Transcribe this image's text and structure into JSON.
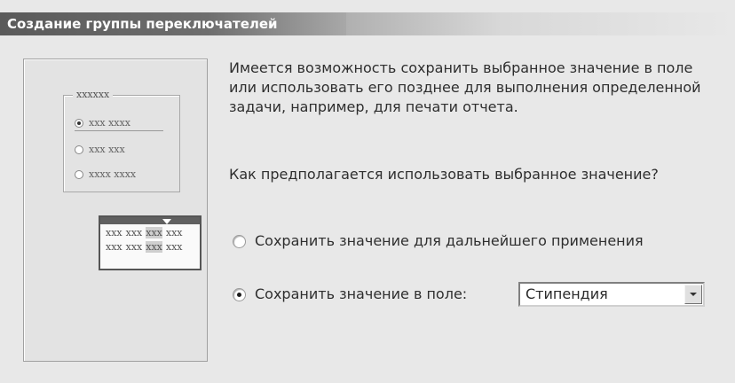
{
  "window": {
    "title": "Создание группы переключателей"
  },
  "preview": {
    "group_label": "xxxxxx",
    "radios": [
      "xxx xxxx",
      "xxx xxx",
      "xxxx xxxx"
    ],
    "selected_index": 0,
    "table_rows": [
      [
        "xxx",
        "xxx",
        "xxx",
        "xxx"
      ],
      [
        "xxx",
        "xxx",
        "xxx",
        "xxx"
      ]
    ]
  },
  "main": {
    "intro": "Имеется возможность сохранить выбранное значение в поле или использовать его позднее для выполнения определенной задачи, например, для печати отчета.",
    "question": "Как предполагается использовать выбранное значение?",
    "options": [
      {
        "label": "Сохранить значение для дальнейшего применения",
        "selected": false
      },
      {
        "label": "Сохранить значение в поле:",
        "selected": true
      }
    ],
    "field_select": {
      "value": "Стипендия"
    }
  }
}
